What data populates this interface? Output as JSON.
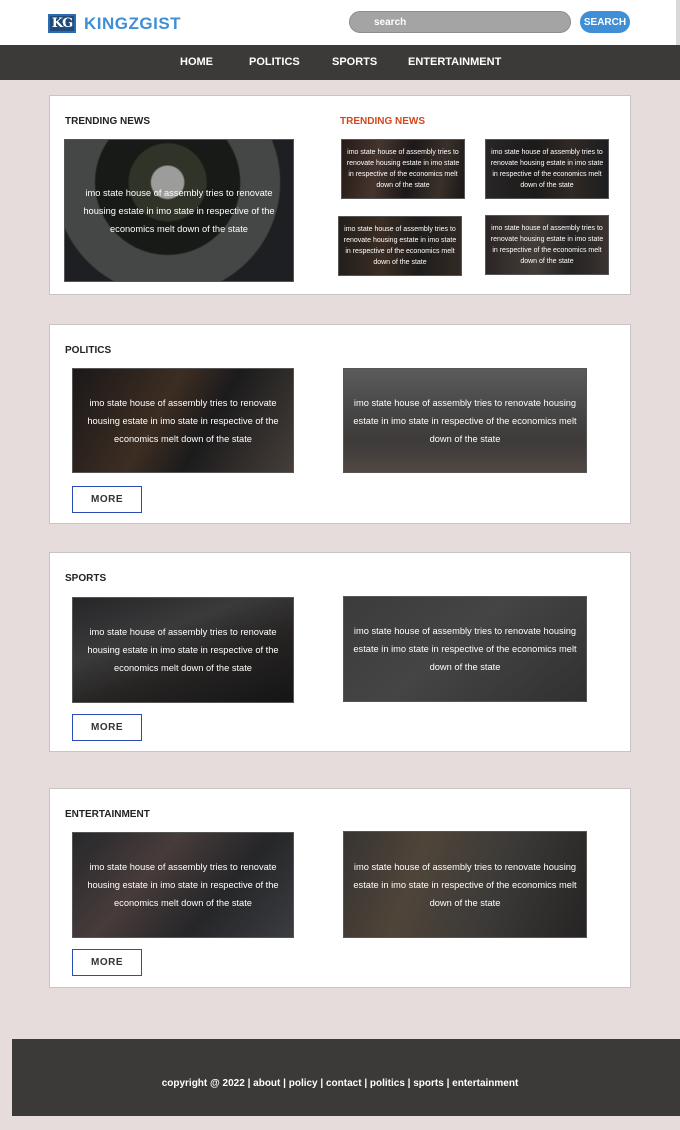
{
  "header": {
    "logo_mark": "KG",
    "brand": "KINGZGIST",
    "search_placeholder": "search",
    "search_button": "SEARCH"
  },
  "nav": {
    "items": [
      "HOME",
      "POLITICS",
      "SPORTS",
      "ENTERTAINMENT"
    ]
  },
  "caption": "imo state house of assembly tries to renovate housing estate in imo state in respective of the economics melt down of the state",
  "trending": {
    "title": "TRENDING NEWS",
    "right_title": "TRENDING NEWS"
  },
  "politics": {
    "title": "POLITICS",
    "more": "MORE"
  },
  "sports": {
    "title": "SPORTS",
    "more": "MORE"
  },
  "entertainment": {
    "title": "ENTERTAINMENT",
    "more": "MORE"
  },
  "footer": {
    "text": "copyright @ 2022 | about | policy | contact | politics | sports | entertainment"
  },
  "colors": {
    "brand_blue": "#3f8fd6",
    "nav_bg": "#3c3939",
    "page_bg": "#e6dcdc",
    "trending_accent": "#d4471d",
    "more_border": "#2c4db5"
  }
}
